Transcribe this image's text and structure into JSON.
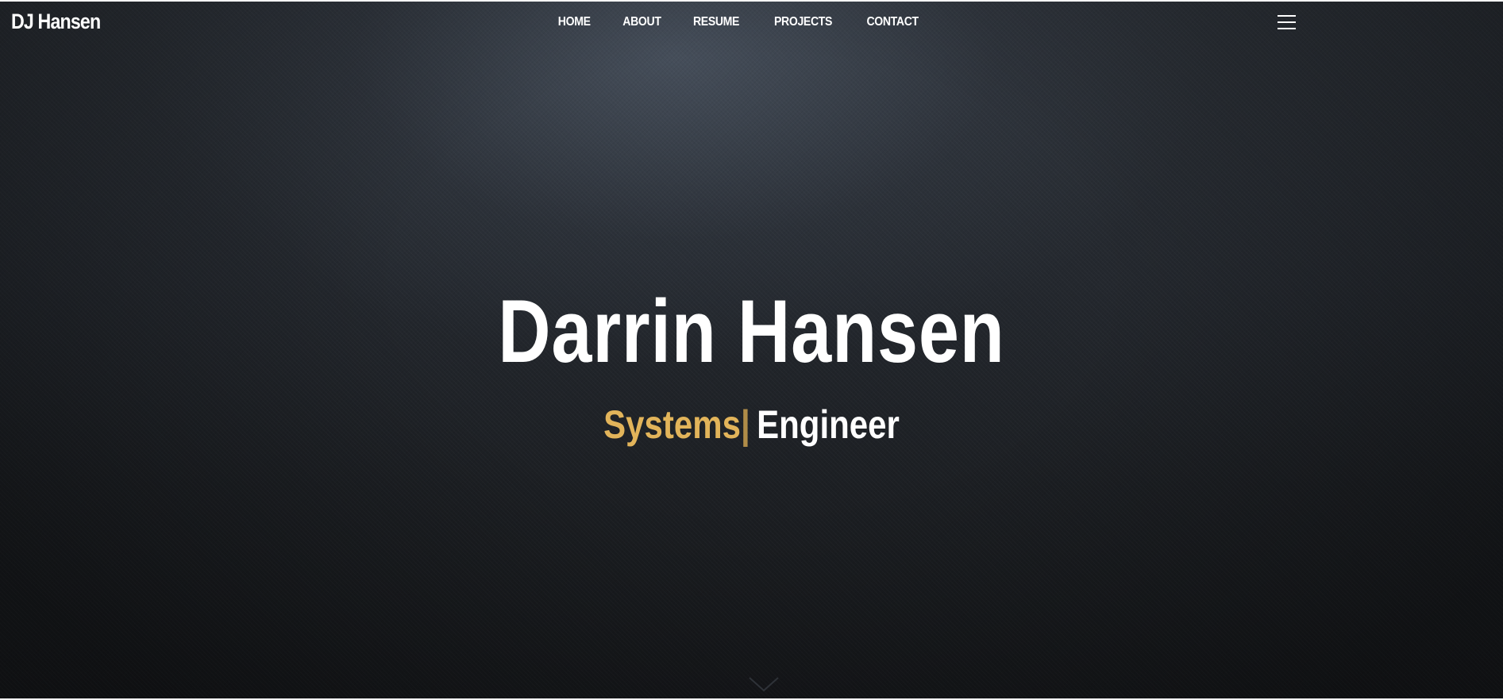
{
  "header": {
    "brand": "DJ Hansen",
    "nav": [
      "HOME",
      "ABOUT",
      "RESUME",
      "PROJECTS",
      "CONTACT"
    ],
    "menu_icon": "hamburger-menu-icon"
  },
  "hero": {
    "name": "Darrin Hansen",
    "subtitle_typed": "Systems",
    "subtitle_cursor": "|",
    "subtitle_rest": "Engineer",
    "scroll_icon": "chevron-down-icon"
  },
  "colors": {
    "accent": "#e2b45a",
    "text": "#ffffff",
    "background": "#1f2226"
  }
}
